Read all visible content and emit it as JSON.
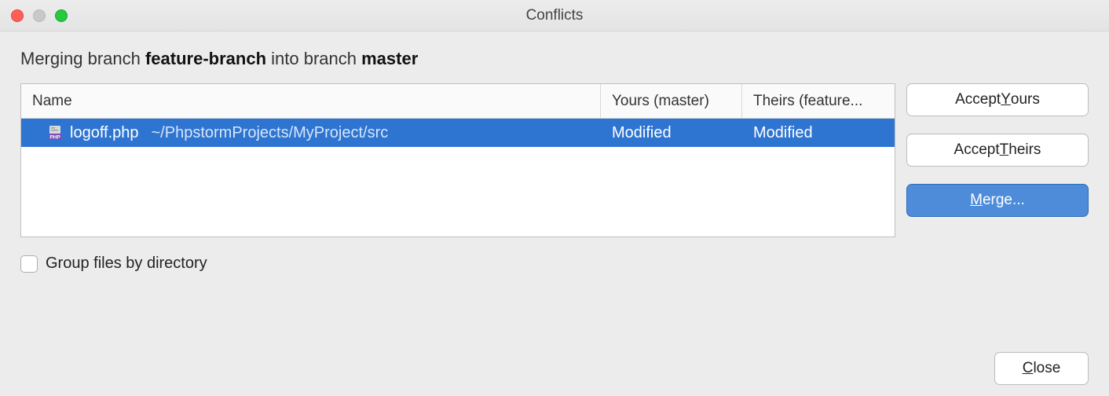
{
  "window": {
    "title": "Conflicts"
  },
  "heading": {
    "prefix": "Merging branch ",
    "source_branch": "feature-branch",
    "middle": " into branch ",
    "target_branch": "master"
  },
  "table": {
    "columns": {
      "name": "Name",
      "yours": "Yours (master)",
      "theirs": "Theirs (feature..."
    },
    "rows": [
      {
        "icon": "php-file-icon",
        "filename": "logoff.php",
        "dir": "~/PhpstormProjects/MyProject/src",
        "yours": "Modified",
        "theirs": "Modified"
      }
    ]
  },
  "buttons": {
    "accept_yours": "Accept Yours",
    "accept_theirs": "Accept Theirs",
    "merge": "Merge...",
    "close": "Close"
  },
  "checkbox": {
    "label": "Group files by directory",
    "checked": false
  },
  "colors": {
    "primary": "#2e74d1"
  }
}
